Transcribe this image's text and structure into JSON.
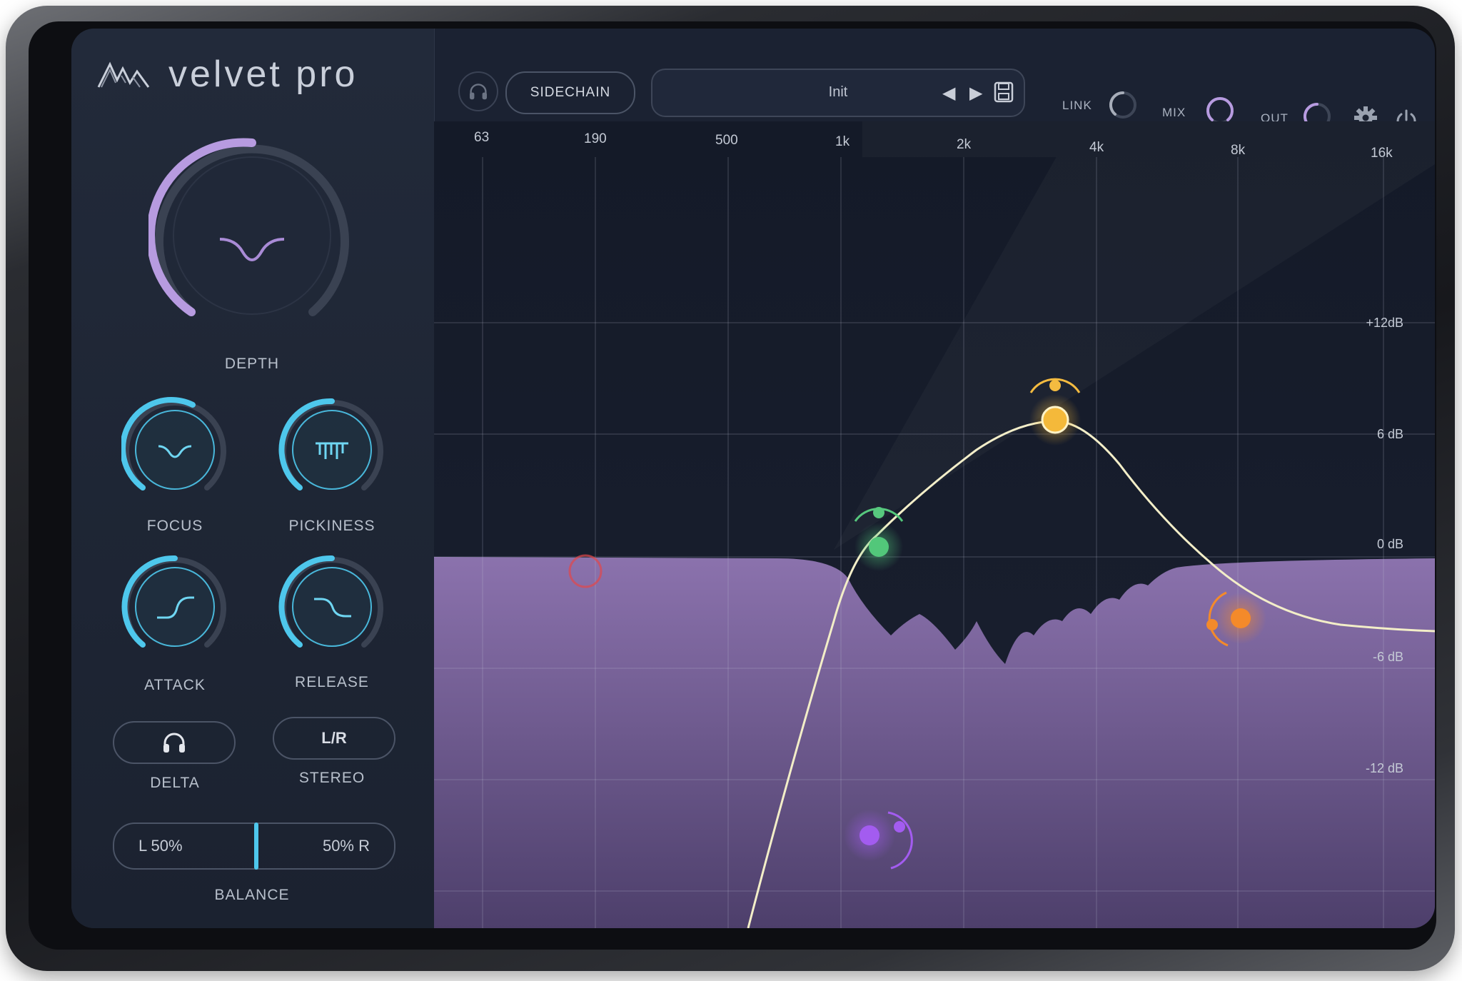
{
  "app": {
    "brand": "velvet pro"
  },
  "controls": {
    "depth": {
      "label": "DEPTH"
    },
    "focus": {
      "label": "FOCUS"
    },
    "pickiness": {
      "label": "PICKINESS"
    },
    "attack": {
      "label": "ATTACK"
    },
    "release": {
      "label": "RELEASE"
    },
    "delta": {
      "label": "DELTA"
    },
    "stereo": {
      "label": "STEREO",
      "button": "L/R"
    },
    "balance": {
      "label": "BALANCE",
      "left": "L  50%",
      "right": "50%  R"
    }
  },
  "topbar": {
    "sidechain": "SIDECHAIN",
    "preset": "Init",
    "link": "LINK",
    "mix": "MIX",
    "out": "OUT"
  },
  "graph": {
    "freq_labels": [
      "63",
      "190",
      "500",
      "1k",
      "2k",
      "4k",
      "8k",
      "16k"
    ],
    "db_labels": [
      "+12dB",
      "6 dB",
      "0 dB",
      "-6 dB",
      "-12 dB"
    ]
  },
  "colors": {
    "accent_purple": "#a98bd6",
    "accent_cyan": "#4ec7ec",
    "node_green": "#52c77a",
    "node_yellow": "#f4b93a",
    "node_orange": "#f48a2a",
    "node_violet": "#a35cf0",
    "node_red": "#e2474a"
  }
}
